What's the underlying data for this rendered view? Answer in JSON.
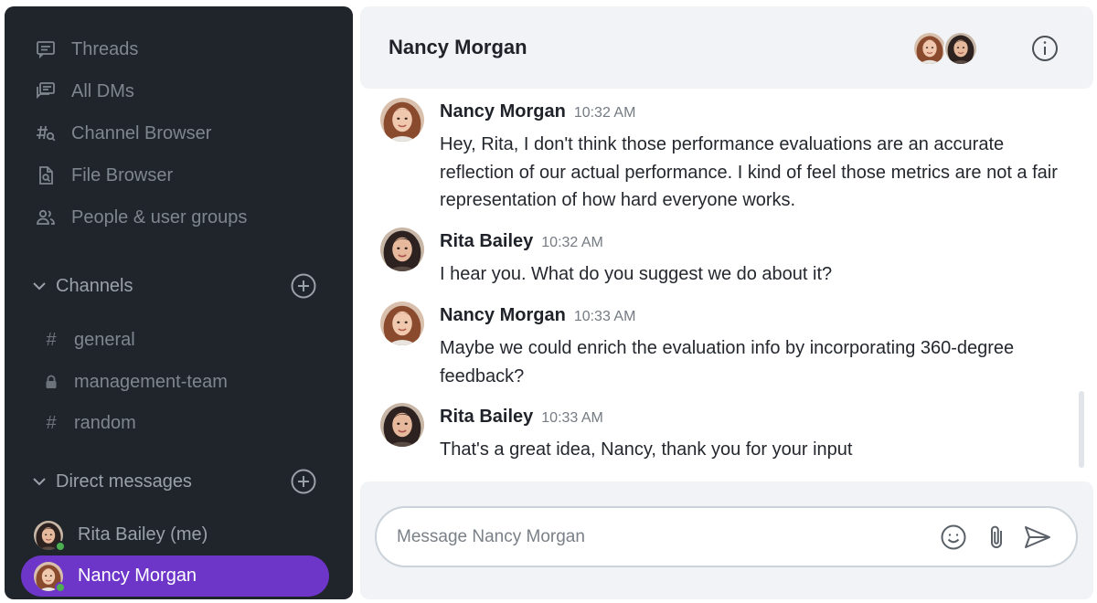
{
  "sidebar": {
    "nav": [
      {
        "label": "Threads",
        "icon": "threads-icon"
      },
      {
        "label": "All DMs",
        "icon": "all-dms-icon"
      },
      {
        "label": "Channel Browser",
        "icon": "channel-browser-icon"
      },
      {
        "label": "File Browser",
        "icon": "file-browser-icon"
      },
      {
        "label": "People & user groups",
        "icon": "people-icon"
      }
    ],
    "channels": {
      "label": "Channels",
      "items": [
        {
          "name": "general",
          "type": "public"
        },
        {
          "name": "management-team",
          "type": "private"
        },
        {
          "name": "random",
          "type": "public"
        }
      ]
    },
    "direct_messages": {
      "label": "Direct messages",
      "items": [
        {
          "name": "Rita Bailey (me)",
          "status": "online",
          "active": false
        },
        {
          "name": "Nancy Morgan",
          "status": "online",
          "active": true
        }
      ]
    }
  },
  "chat": {
    "title": "Nancy Morgan",
    "messages": [
      {
        "author": "Nancy Morgan",
        "time": "10:32 AM",
        "text": "Hey, Rita, I don't think those performance evaluations are an accurate reflection of our actual performance. I kind of feel those metrics are not a fair representation of how hard everyone works."
      },
      {
        "author": "Rita Bailey",
        "time": "10:32 AM",
        "text": "I hear you. What do you suggest we do about it?"
      },
      {
        "author": "Nancy Morgan",
        "time": "10:33 AM",
        "text": "Maybe we could enrich the evaluation info by incorporating 360-degree feedback?"
      },
      {
        "author": "Rita Bailey",
        "time": "10:33 AM",
        "text": "That's a great idea, Nancy, thank you for your input"
      }
    ],
    "composer": {
      "placeholder": "Message Nancy Morgan",
      "value": ""
    }
  },
  "colors": {
    "sidebar_bg": "#20252c",
    "active_dm": "#6d35c8",
    "presence_online": "#4caf50",
    "header_bg": "#f1f3f6"
  }
}
